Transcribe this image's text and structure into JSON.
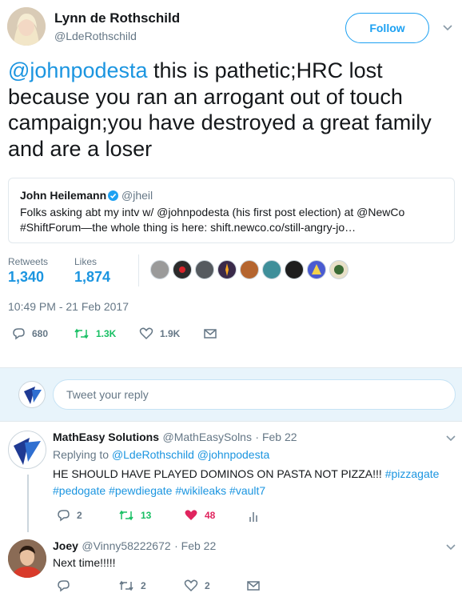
{
  "tweet": {
    "author_name": "Lynn de Rothschild",
    "author_handle": "@LdeRothschild",
    "follow_label": "Follow",
    "mention": "@johnpodesta",
    "body": " this is pathetic;HRC lost because you ran an arrogant out of touch campaign;you have destroyed a great family and are a loser",
    "timestamp": "10:49 PM - 21 Feb 2017",
    "retweets_label": "Retweets",
    "retweets_value": "1,340",
    "likes_label": "Likes",
    "likes_value": "1,874",
    "replies_count": "680",
    "retweet_count": "1.3K",
    "like_count": "1.9K"
  },
  "quote": {
    "name": "John Heilemann",
    "handle": "@jheil",
    "line1": "Folks asking abt my intv w/ @johnpodesta (his first post election) at @NewCo",
    "line2": "#ShiftForum—the whole thing is here: shift.newco.co/still-angry-jo…"
  },
  "reply_box": {
    "placeholder": "Tweet your reply"
  },
  "replies": [
    {
      "name": "MathEasy Solutions",
      "handle": "@MathEasySolns",
      "date": "· Feb 22",
      "replying_prefix": "Replying to ",
      "replying_to": "@LdeRothschild @johnpodesta",
      "text": "HE SHOULD HAVE PLAYED DOMINOS ON PASTA NOT PIZZA!!! ",
      "hashtags_line1": "#pizzagate",
      "hashtags_line2": "#pedogate #pewdiegate #wikileaks #vault7",
      "reply_count": "2",
      "retweet_count": "13",
      "like_count": "48"
    },
    {
      "name": "Joey",
      "handle": "@Vinny58222672",
      "date": "· Feb 22",
      "text": "Next time!!!!!",
      "retweet_count": "2",
      "like_count": "2"
    }
  ],
  "colors": {
    "link": "#1b95e0",
    "retweet_green": "#17bf63",
    "like_red": "#e0245e",
    "reply_bar_bg": "#e8f4fb"
  }
}
